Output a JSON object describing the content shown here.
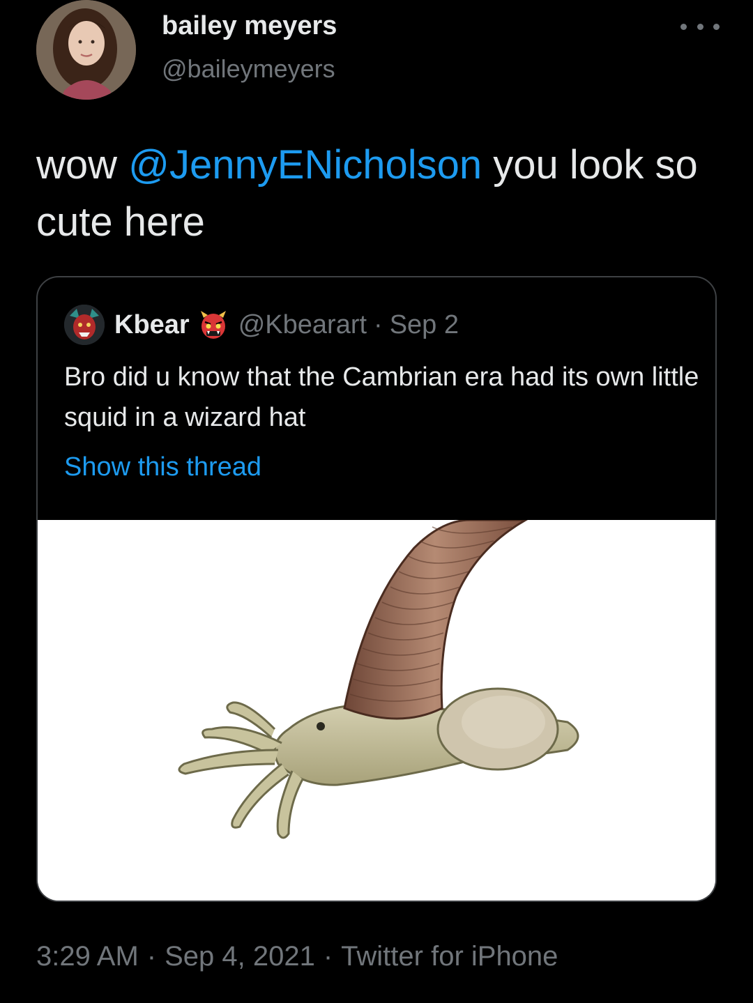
{
  "author": {
    "name": "bailey meyers",
    "handle": "@baileymeyers"
  },
  "tweet": {
    "text_before": "wow ",
    "mention": "@JennyENicholson",
    "text_after": " you look so cute here"
  },
  "quote": {
    "name": "Kbear",
    "name_emoji_icon": "japanese-ogre-emoji",
    "handle": "@Kbearart",
    "separator": "·",
    "date": "Sep 2",
    "text": "Bro did u know that the Cambrian era had its own little squid in a wizard hat",
    "show_thread": "Show this thread"
  },
  "meta": {
    "time": "3:29 AM",
    "separator": "·",
    "date": "Sep 4, 2021",
    "source": "Twitter for iPhone"
  },
  "colors": {
    "background": "#000000",
    "primary_text": "#e7e9ea",
    "secondary_text": "#71767b",
    "link": "#1d9bf0",
    "card_border": "#3e4144"
  }
}
